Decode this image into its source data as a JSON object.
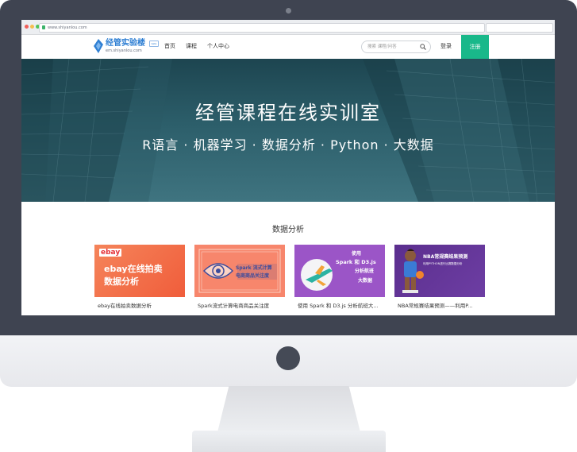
{
  "browser": {
    "url": "www.shiyanlou.com"
  },
  "header": {
    "logo_title": "经管实验楼",
    "logo_sub": "em.shiyanlou.com",
    "logo_badge": "beta",
    "nav": [
      "首页",
      "课程",
      "个人中心"
    ],
    "search_placeholder": "搜索 课程/问答",
    "login": "登录",
    "register": "注册"
  },
  "hero": {
    "title": "经管课程在线实训室",
    "subtitle": "R语言 · 机器学习 · 数据分析 · Python · 大数据"
  },
  "section": {
    "title": "数据分析"
  },
  "cards": [
    {
      "thumb_brand": "ebay",
      "thumb_line1": "ebay在线拍卖",
      "thumb_line2": "数据分析",
      "caption": "ebay在线拍卖数据分析"
    },
    {
      "thumb_brand": "Spark 流式计算",
      "thumb_line1": "电商商品关注度",
      "caption": "Spark流式计算电商商品关注度"
    },
    {
      "thumb_line1": "使用",
      "thumb_line2": "Spark 和 D3.js",
      "thumb_line3": "分析航班",
      "thumb_line4": "大数据",
      "caption": "使用 Spark 和 D3.js 分析航班大..."
    },
    {
      "thumb_line1": "NBA常规赛结果预测",
      "thumb_line2": "利用PYTHON进行比赛数据分析",
      "caption": "NBA常规赛结果预测——利用P..."
    }
  ],
  "colors": {
    "bezel": "#3f4451",
    "accent_green": "#19b88a",
    "brand_blue": "#2f7fd3",
    "hero_teal": "#2c5e6a"
  }
}
